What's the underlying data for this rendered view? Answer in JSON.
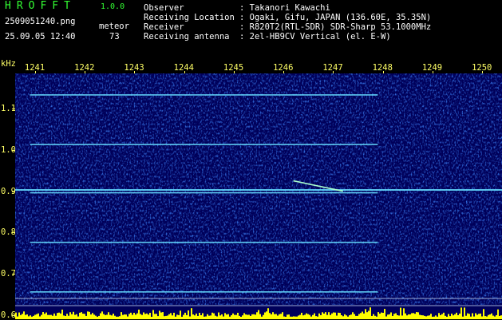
{
  "header": {
    "brand": "HROFFT",
    "version": "1.0.0",
    "file": "2509051240.png",
    "date": "25.09.05 12:40",
    "meteor_label": "meteor",
    "meteor_count": "73",
    "info": [
      {
        "key": "Observer",
        "value": ": Takanori Kawachi"
      },
      {
        "key": "Receiving Location",
        "value": ": Ogaki, Gifu, JAPAN (136.60E, 35.35N)"
      },
      {
        "key": "Receiver",
        "value": ": R820T2(RTL-SDR) SDR-Sharp 53.1000MHz"
      },
      {
        "key": "Receiving antenna",
        "value": ": 2el-HB9CV Vertical (el. E-W)"
      }
    ]
  },
  "chart_data": {
    "type": "heatmap",
    "x_unit": "minute (HHMM)",
    "x_ticks": [
      "1241",
      "1242",
      "1243",
      "1244",
      "1245",
      "1246",
      "1247",
      "1248",
      "1249",
      "1250"
    ],
    "y_unit": "kHz",
    "y_ticks": [
      "1.1",
      "1.0",
      "0.9",
      "0.8",
      "0.7",
      "0.6"
    ],
    "xlim": [
      1240.6,
      1250.4
    ],
    "ylim": [
      0.59,
      1.185
    ],
    "carriers_khz": [
      1.133,
      1.013,
      0.896,
      0.776,
      0.656
    ],
    "main_carrier_khz": 0.903,
    "meteor_echo": {
      "start_min": 1246.2,
      "end_min": 1247.2,
      "start_khz": 0.925,
      "end_khz": 0.9
    }
  },
  "colors": {
    "background": "#000000",
    "brand": "#33ff33",
    "header_text": "#ffffff",
    "axis": "#ffff66",
    "spectrum_base": "#00005a",
    "signal": "#66ddff",
    "noise_floor": "#ffff00"
  }
}
